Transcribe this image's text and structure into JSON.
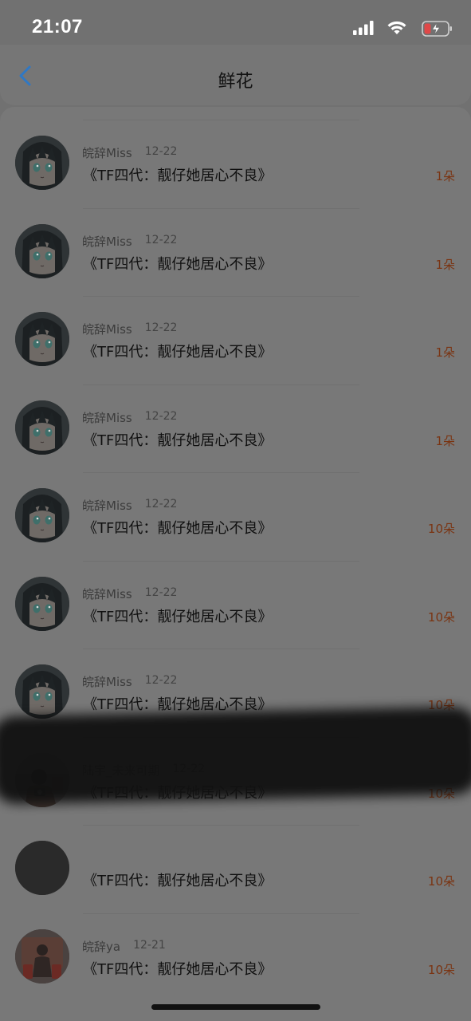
{
  "status_bar": {
    "time": "21:07",
    "icons": [
      "signal-icon",
      "wifi-icon",
      "battery-charging-icon"
    ],
    "battery_color": "#e04848"
  },
  "nav": {
    "back_icon": "chevron-left-icon",
    "title": "鲜花",
    "accent_color": "#2f78c4"
  },
  "items": [
    {
      "user": "皖辞Miss",
      "date": "12-22",
      "title": "《TF四代：靓仔她居心不良》",
      "count": "1朵",
      "avatar": "anime-girl"
    },
    {
      "user": "皖辞Miss",
      "date": "12-22",
      "title": "《TF四代：靓仔她居心不良》",
      "count": "1朵",
      "avatar": "anime-girl"
    },
    {
      "user": "皖辞Miss",
      "date": "12-22",
      "title": "《TF四代：靓仔她居心不良》",
      "count": "1朵",
      "avatar": "anime-girl"
    },
    {
      "user": "皖辞Miss",
      "date": "12-22",
      "title": "《TF四代：靓仔她居心不良》",
      "count": "1朵",
      "avatar": "anime-girl"
    },
    {
      "user": "皖辞Miss",
      "date": "12-22",
      "title": "《TF四代：靓仔她居心不良》",
      "count": "10朵",
      "avatar": "anime-girl"
    },
    {
      "user": "皖辞Miss",
      "date": "12-22",
      "title": "《TF四代：靓仔她居心不良》",
      "count": "10朵",
      "avatar": "anime-girl"
    },
    {
      "user": "皖辞Miss",
      "date": "12-22",
      "title": "《TF四代：靓仔她居心不良》",
      "count": "10朵",
      "avatar": "anime-girl"
    },
    {
      "user": "陆宇_未来可期",
      "date": "12-22",
      "title": "《TF四代：靓仔她居心不良》",
      "count": "10朵",
      "avatar": "photo"
    },
    {
      "user": "",
      "date": "",
      "title": "《TF四代：靓仔她居心不良》",
      "count": "10朵",
      "avatar": "redacted"
    },
    {
      "user": "皖辞ya",
      "date": "12-21",
      "title": "《TF四代：靓仔她居心不良》",
      "count": "10朵",
      "avatar": "photo2"
    }
  ],
  "count_color": "#7a3412"
}
